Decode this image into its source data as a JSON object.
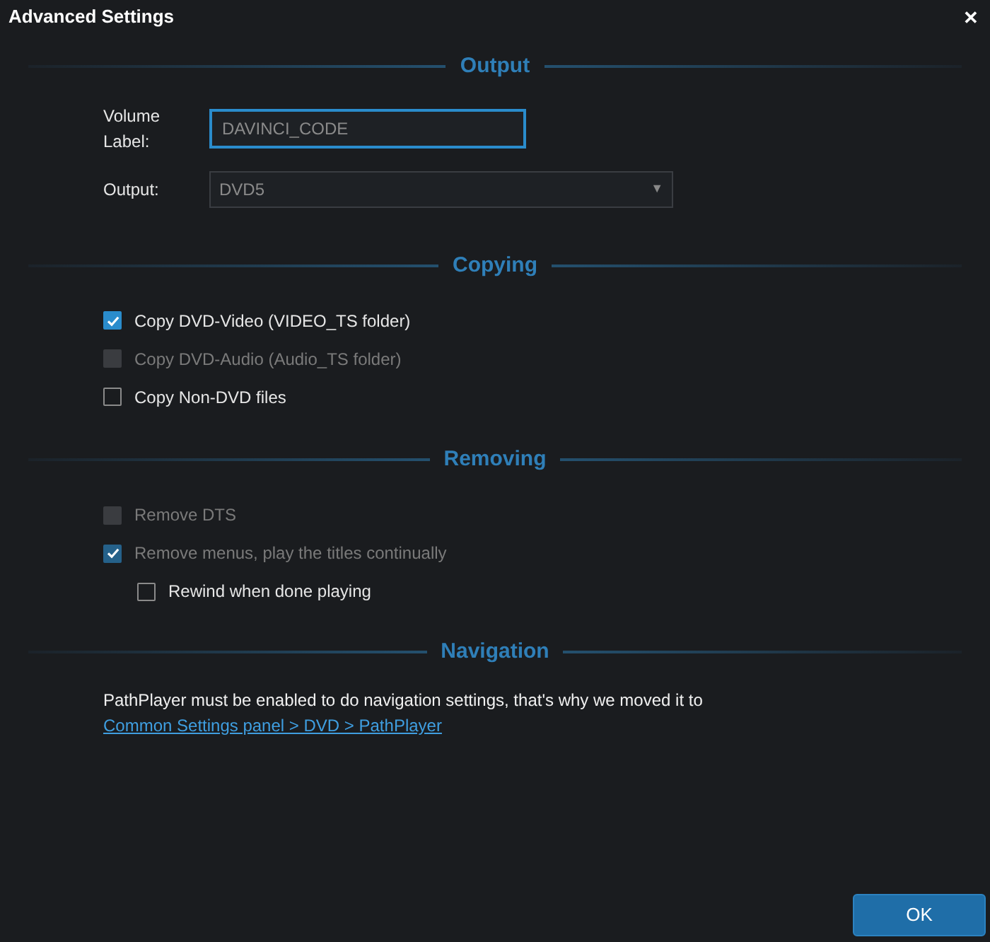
{
  "window": {
    "title": "Advanced Settings",
    "close": "✕"
  },
  "sections": [
    {
      "title": "Output",
      "kind": "fields",
      "fields": [
        {
          "kind": "text",
          "label": "Volume Label:",
          "value": "DAVINCI_CODE",
          "focused": true
        },
        {
          "kind": "select",
          "label": "Output:",
          "value": "DVD5",
          "caret": "▼",
          "focused": false
        }
      ]
    },
    {
      "title": "Copying",
      "kind": "checks",
      "items": [
        {
          "label": "Copy DVD-Video (VIDEO_TS folder)",
          "checked": true,
          "disabled": false
        },
        {
          "label": "Copy DVD-Audio (Audio_TS folder)",
          "checked": false,
          "disabled": true
        },
        {
          "label": "Copy Non-DVD files",
          "checked": false,
          "disabled": false
        }
      ]
    },
    {
      "title": "Removing",
      "kind": "checks",
      "items": [
        {
          "label": "Remove DTS",
          "checked": false,
          "disabled": true
        },
        {
          "label": "Remove menus, play the titles continually",
          "checked": true,
          "disabled": true,
          "children": [
            {
              "label": "Rewind when done playing",
              "checked": false,
              "disabled": false
            }
          ]
        }
      ]
    },
    {
      "title": "Navigation",
      "kind": "note",
      "text": "PathPlayer must be enabled to do navigation settings, that's why we moved it to",
      "link": "Common Settings panel > DVD > PathPlayer"
    }
  ],
  "buttons": [
    {
      "label": "OK"
    }
  ]
}
